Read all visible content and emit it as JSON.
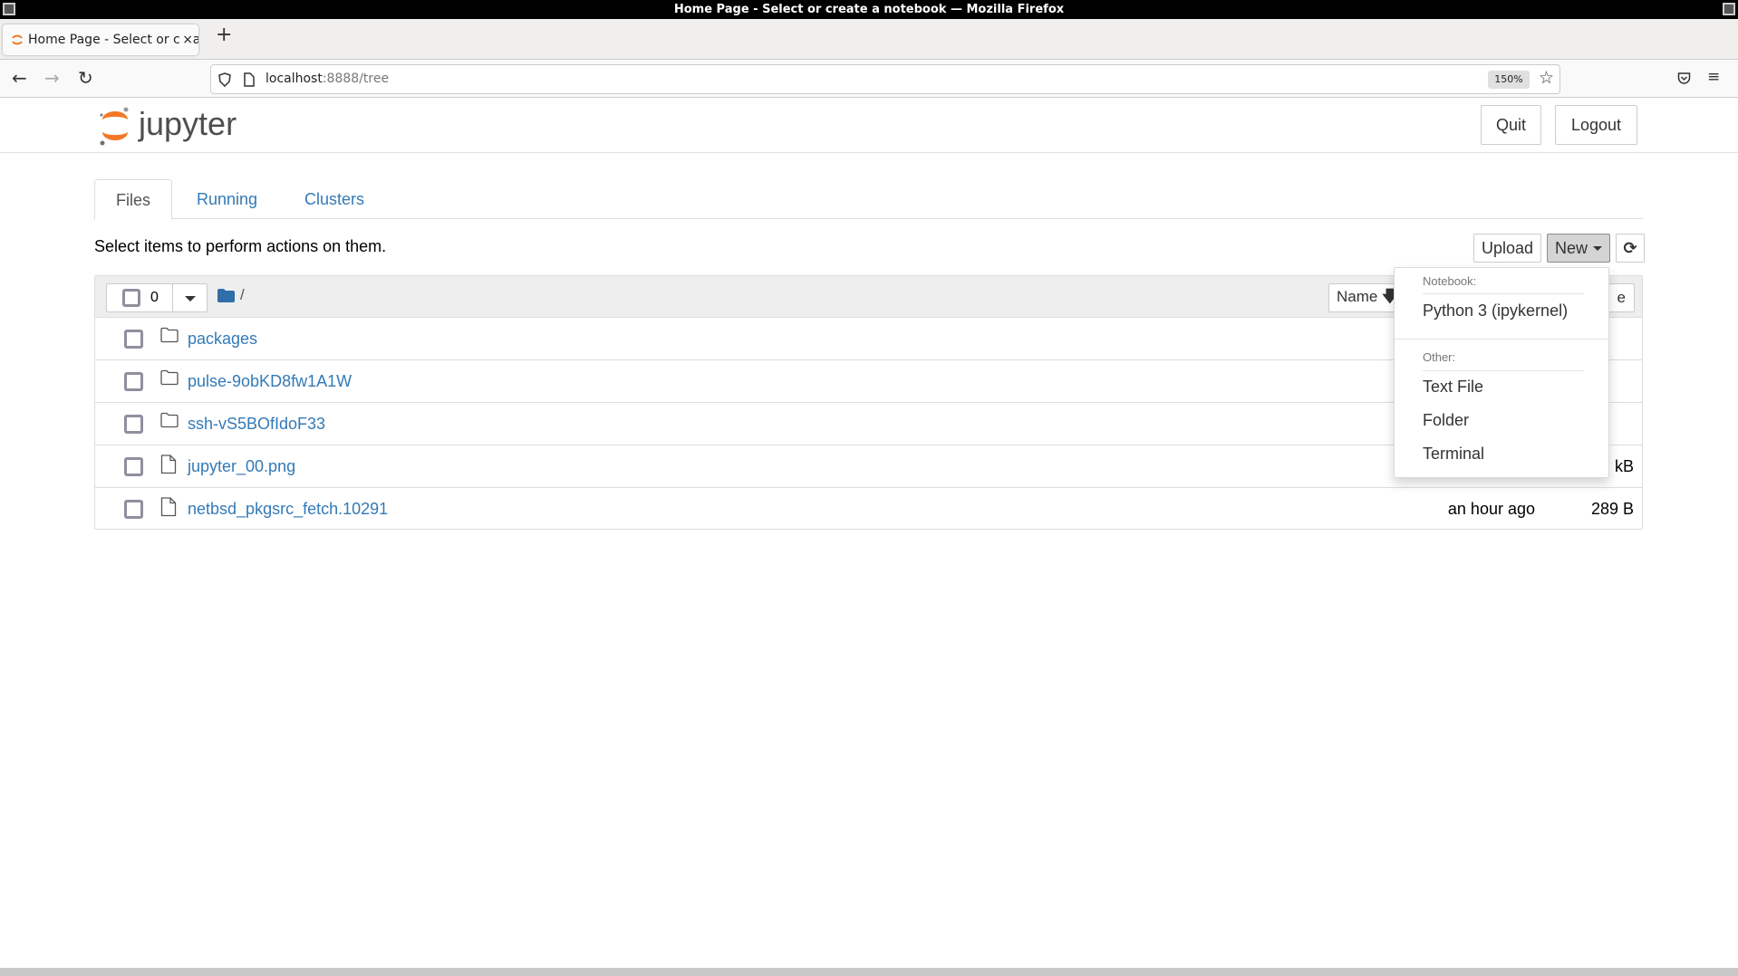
{
  "window": {
    "title": "Home Page - Select or create a notebook — Mozilla Firefox"
  },
  "browser": {
    "tab_title": "Home Page - Select or create a notebook",
    "new_tab_label": "+",
    "url_host": "localhost",
    "url_rest": ":8888/tree",
    "zoom_level": "150%",
    "icons": [
      "back-icon",
      "forward-icon",
      "reload-icon",
      "shield-icon",
      "page-icon",
      "star-icon",
      "pocket-icon",
      "menu-icon"
    ]
  },
  "header": {
    "logo_text": "jupyter",
    "quit_label": "Quit",
    "logout_label": "Logout"
  },
  "tabs": [
    {
      "label": "Files",
      "active": true
    },
    {
      "label": "Running"
    },
    {
      "label": "Clusters"
    }
  ],
  "toolbar": {
    "hint": "Select items to perform actions on them.",
    "upload_label": "Upload",
    "new_label": "New"
  },
  "list_header": {
    "selected_count": "0",
    "path": "/",
    "name_sort_label": "Name",
    "size_sort_partial": "e"
  },
  "files": [
    {
      "name": "packages",
      "type": "folder",
      "modified": "",
      "size": ""
    },
    {
      "name": "pulse-9obKD8fw1A1W",
      "type": "folder",
      "modified": "",
      "size": ""
    },
    {
      "name": "ssh-vS5BOfIdoF33",
      "type": "folder",
      "modified": "",
      "size": ""
    },
    {
      "name": "jupyter_00.png",
      "type": "file",
      "modified": "",
      "size": "kB"
    },
    {
      "name": "netbsd_pkgsrc_fetch.10291",
      "type": "file",
      "modified": "an hour ago",
      "size": "289 B"
    }
  ],
  "new_menu": {
    "notebook_header": "Notebook:",
    "kernels": [
      "Python 3 (ipykernel)"
    ],
    "other_header": "Other:",
    "other_items": [
      "Text File",
      "Folder",
      "Terminal"
    ]
  },
  "colors": {
    "link": "#337ab7",
    "jupyter_orange": "#f37726"
  }
}
